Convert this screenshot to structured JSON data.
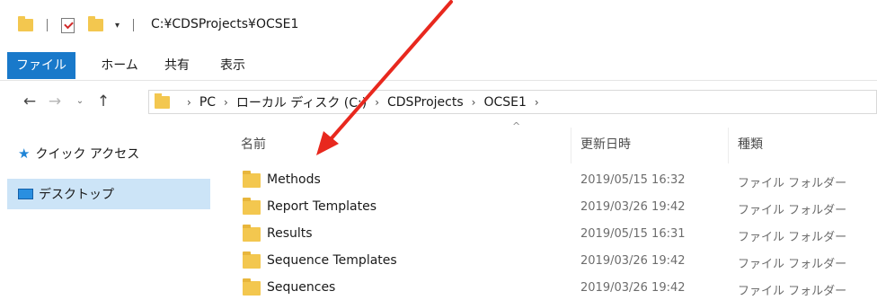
{
  "titlebar": {
    "path": "C:¥CDSProjects¥OCSE1",
    "qa_dropdown": "▾"
  },
  "ribbon": {
    "tabs": [
      "ファイル",
      "ホーム",
      "共有",
      "表示"
    ]
  },
  "nav": {
    "back": "←",
    "forward": "→",
    "recent": "⌄",
    "up": "↑"
  },
  "address": {
    "segments": [
      "PC",
      "ローカル ディスク (C:)",
      "CDSProjects",
      "OCSE1"
    ]
  },
  "navpane": {
    "items": [
      {
        "label": "クイック アクセス",
        "icon": "star-icon"
      },
      {
        "label": "デスクトップ",
        "icon": "desktop-icon"
      }
    ]
  },
  "columns": {
    "name": "名前",
    "date": "更新日時",
    "type": "種類"
  },
  "files": [
    {
      "name": "Methods",
      "date": "2019/05/15 16:32",
      "type": "ファイル フォルダー"
    },
    {
      "name": "Report Templates",
      "date": "2019/03/26 19:42",
      "type": "ファイル フォルダー"
    },
    {
      "name": "Results",
      "date": "2019/05/15 16:31",
      "type": "ファイル フォルダー"
    },
    {
      "name": "Sequence Templates",
      "date": "2019/03/26 19:42",
      "type": "ファイル フォルダー"
    },
    {
      "name": "Sequences",
      "date": "2019/03/26 19:42",
      "type": "ファイル フォルダー"
    }
  ],
  "colors": {
    "accent": "#1979ca",
    "selection": "#cce4f7",
    "folder": "#f3c74f",
    "annotation_arrow": "#e8281e"
  }
}
